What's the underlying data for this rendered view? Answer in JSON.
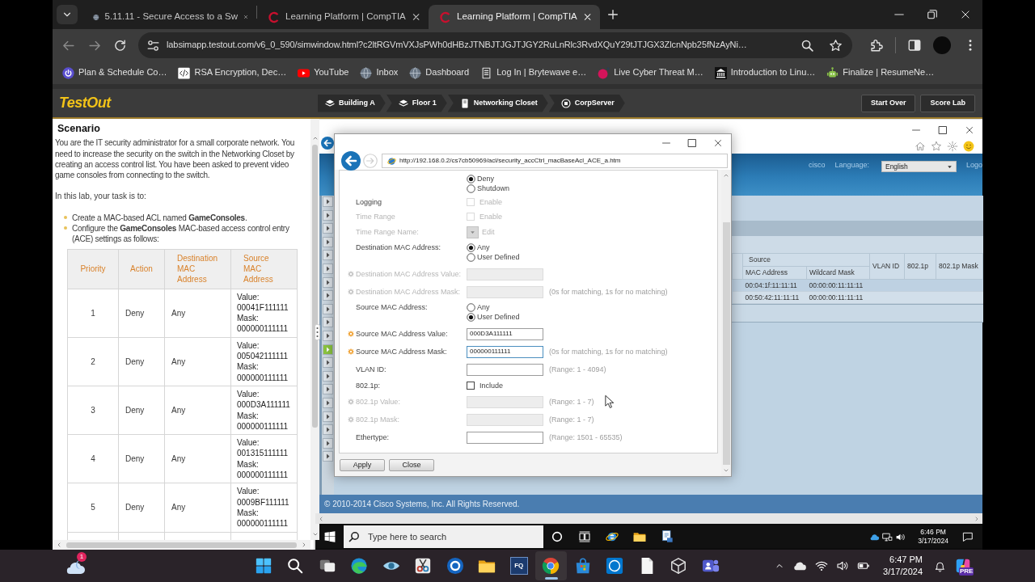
{
  "browser": {
    "tabs": [
      {
        "kind": "globe",
        "title": "5.11.11 - Secure Access to a Sw",
        "selected": false
      },
      {
        "kind": "comptia",
        "title": "Learning Platform | CompTIA",
        "selected": false
      },
      {
        "kind": "comptia",
        "title": "Learning Platform | CompTIA",
        "selected": true
      }
    ],
    "url": "labsimapp.testout.com/v6_0_590/simwindow.html?c2ltRGVmVXJsPWh0dHBzJTNBJTJGJTJGY2RuLnRlc3RvdXQuY29tJTJGX3ZlcnNpb25fNzAyNi…",
    "bookmarks": [
      {
        "kind": "power",
        "label": "Plan & Schedule Co…"
      },
      {
        "kind": "code",
        "label": "RSA Encryption, Dec…"
      },
      {
        "kind": "video",
        "label": "YouTube"
      },
      {
        "kind": "globe",
        "label": "Inbox"
      },
      {
        "kind": "globe",
        "label": "Dashboard"
      },
      {
        "kind": "document",
        "label": "Log In | Brytewave e…"
      },
      {
        "kind": "dot",
        "label": "Live Cyber Threat M…"
      },
      {
        "kind": "building",
        "label": "Introduction to Linu…"
      },
      {
        "kind": "robot",
        "label": "Finalize | ResumeNe…"
      }
    ]
  },
  "lab_bar": {
    "logo": "TestOut",
    "breadcrumbs": [
      {
        "kind": "layers",
        "label": "Building A"
      },
      {
        "kind": "layers",
        "label": "Floor 1"
      },
      {
        "kind": "rack",
        "label": "Networking Closet"
      },
      {
        "kind": "server",
        "label": "CorpServer"
      }
    ],
    "buttons": [
      "Start Over",
      "Score Lab"
    ]
  },
  "scenario": {
    "title": "Scenario",
    "intro": "You are the IT security administrator for a small corporate network. You need to increase the security on the switch in the Networking Closet by creating an access control list. You have been asked to prevent video game consoles from connecting to the switch.",
    "task_lead": "In this lab, your task is to:",
    "bullets": [
      "Create a MAC-based ACL named **GameConsoles**.",
      "Configure the **GameConsoles** MAC-based access control entry (ACE) settings as follows:"
    ],
    "table": {
      "columns": [
        "Priority",
        "Action",
        "Destination MAC Address",
        "Source MAC Address"
      ],
      "rows": [
        {
          "priority": "1",
          "action": "Deny",
          "destination": "Any",
          "value_label": "Value:",
          "value": "00041F111111",
          "mask_label": "Mask:",
          "mask": "000000111111"
        },
        {
          "priority": "2",
          "action": "Deny",
          "destination": "Any",
          "value_label": "Value:",
          "value": "005042111111",
          "mask_label": "Mask:",
          "mask": "000000111111"
        },
        {
          "priority": "3",
          "action": "Deny",
          "destination": "Any",
          "value_label": "Value:",
          "value": "000D3A111111",
          "mask_label": "Mask:",
          "mask": "000000111111"
        },
        {
          "priority": "4",
          "action": "Deny",
          "destination": "Any",
          "value_label": "Value:",
          "value": "001315111111",
          "mask_label": "Mask:",
          "mask": "000000111111"
        },
        {
          "priority": "5",
          "action": "Deny",
          "destination": "Any",
          "value_label": "Value:",
          "value": "0009BF111111",
          "mask_label": "Mask:",
          "mask": "000000111111"
        }
      ]
    }
  },
  "simulator": {
    "cisco_page": {
      "brand": "cisco",
      "language_label": "Language:",
      "language": "English",
      "logout": "Logo",
      "nav": [
        {
          "selected": false
        },
        {
          "selected": false
        },
        {
          "selected": false
        },
        {
          "selected": false
        },
        {
          "selected": false
        },
        {
          "selected": false
        },
        {
          "selected": false
        },
        {
          "selected": false
        },
        {
          "selected": false
        },
        {
          "selected": false
        },
        {
          "selected": false
        },
        {
          "selected": true
        },
        {
          "selected": false
        },
        {
          "selected": false
        },
        {
          "selected": false
        },
        {
          "selected": false
        },
        {
          "selected": false
        },
        {
          "selected": false
        },
        {
          "selected": false
        },
        {
          "selected": false
        }
      ],
      "table": {
        "group": "Source",
        "group_columns": [
          "MAC Address",
          "Wildcard Mask"
        ],
        "columns": [
          "VLAN ID",
          "802.1p",
          "802.1p Mask"
        ],
        "rows": [
          [
            "00:04:1f:11:11:11",
            "00:00:00:11:11:11"
          ],
          [
            "00:50:42:11:11:11",
            "00:00:00:11:11:11"
          ]
        ]
      },
      "footer": "© 2010-2014 Cisco Systems, Inc. All Rights Reserved."
    },
    "dialog": {
      "url": "http://192.168.0.2/cs7cb50969/acl/security_accCtrl_macBaseAcl_ACE_a.htm",
      "fields": [
        {
          "kind": "radio",
          "disabled": false,
          "required": false,
          "options": [
            {
              "label": "Deny",
              "selected": true
            },
            {
              "label": "Shutdown",
              "selected": false
            }
          ]
        },
        {
          "kind": "checkbox",
          "label": "Logging",
          "label_disabled": false,
          "disabled": true,
          "required": false,
          "option": "Enable",
          "checked": false
        },
        {
          "kind": "checkbox",
          "label": "Time Range",
          "label_disabled": true,
          "disabled": true,
          "required": false,
          "option": "Enable",
          "checked": false
        },
        {
          "kind": "select",
          "label": "Time Range Name:",
          "label_disabled": true,
          "disabled": true,
          "required": false,
          "link": "Edit"
        },
        {
          "kind": "radio",
          "label": "Destination MAC Address:",
          "label_disabled": false,
          "disabled": false,
          "required": false,
          "options": [
            {
              "label": "Any",
              "selected": true
            },
            {
              "label": "User Defined",
              "selected": false
            }
          ]
        },
        {
          "kind": "input",
          "label": "Destination MAC Address Value:",
          "label_disabled": true,
          "disabled": true,
          "required": true,
          "focused": false
        },
        {
          "kind": "input",
          "label": "Destination MAC Address Mask:",
          "label_disabled": true,
          "disabled": true,
          "required": true,
          "focused": false,
          "hint": "(0s for matching, 1s for no matching)"
        },
        {
          "kind": "radio",
          "label": "Source MAC Address:",
          "label_disabled": false,
          "disabled": false,
          "required": false,
          "options": [
            {
              "label": "Any",
              "selected": false
            },
            {
              "label": "User Defined",
              "selected": true
            }
          ]
        },
        {
          "kind": "input",
          "label": "Source MAC Address Value:",
          "label_disabled": false,
          "disabled": false,
          "required": true,
          "focused": false,
          "value": "000D3A111111"
        },
        {
          "kind": "input",
          "label": "Source MAC Address Mask:",
          "label_disabled": false,
          "disabled": false,
          "required": true,
          "focused": true,
          "value": "000000111111",
          "hint": "(0s for matching, 1s for no matching)"
        },
        {
          "kind": "input",
          "label": "VLAN ID:",
          "label_disabled": false,
          "disabled": false,
          "required": false,
          "focused": false,
          "hint": "(Range: 1 - 4094)"
        },
        {
          "kind": "checkbox",
          "label": "802.1p:",
          "label_disabled": false,
          "disabled": false,
          "required": false,
          "option": "Include",
          "checked": false
        },
        {
          "kind": "input",
          "label": "802.1p Value:",
          "label_disabled": true,
          "disabled": true,
          "required": true,
          "focused": false,
          "hint": "(Range: 1 - 7)"
        },
        {
          "kind": "input",
          "label": "802.1p Mask:",
          "label_disabled": true,
          "disabled": true,
          "required": true,
          "focused": false,
          "hint": "(Range: 1 - 7)"
        },
        {
          "kind": "input",
          "label": "Ethertype:",
          "label_disabled": false,
          "disabled": false,
          "required": false,
          "focused": false,
          "hint": "(Range: 1501 - 65535)"
        }
      ],
      "buttons": [
        "Apply",
        "Close"
      ]
    },
    "taskbar": {
      "search_placeholder": "Type here to search",
      "apps": [
        {
          "kind": "cortana"
        },
        {
          "kind": "taskview"
        },
        {
          "kind": "ie"
        },
        {
          "kind": "explorer"
        },
        {
          "kind": "app"
        }
      ],
      "time": "6:46 PM",
      "date": "3/17/2024"
    }
  },
  "taskbar": {
    "weather_badge": "1",
    "apps": [
      {
        "kind": "start",
        "selected": false
      },
      {
        "kind": "search",
        "selected": false
      },
      {
        "kind": "taskview",
        "selected": false
      },
      {
        "kind": "edge",
        "selected": false
      },
      {
        "kind": "eye",
        "selected": false
      },
      {
        "kind": "snip",
        "selected": false
      },
      {
        "kind": "q",
        "selected": false
      },
      {
        "kind": "explorer",
        "selected": false
      },
      {
        "kind": "fq",
        "label": "FQ",
        "selected": false
      },
      {
        "kind": "chrome",
        "selected": true
      },
      {
        "kind": "store",
        "selected": false
      },
      {
        "kind": "dell",
        "selected": false
      },
      {
        "kind": "file",
        "selected": false
      },
      {
        "kind": "box",
        "selected": false
      },
      {
        "kind": "teams",
        "selected": false
      }
    ],
    "time": "6:47 PM",
    "date": "3/17/2024",
    "copilot_badge": "PRE"
  }
}
